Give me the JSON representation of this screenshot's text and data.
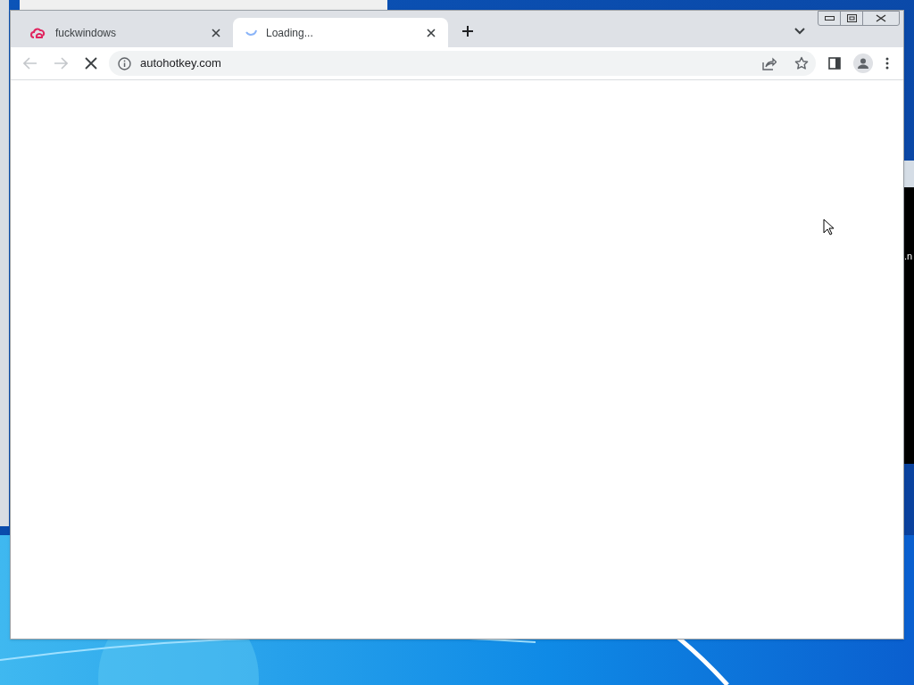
{
  "background_window": {
    "text": ".n"
  },
  "tabs": [
    {
      "title": "fuckwindows",
      "selected": false,
      "loading": false
    },
    {
      "title": "Loading...",
      "selected": true,
      "loading": true
    }
  ],
  "toolbar": {
    "address": "autohotkey.com",
    "loading": true
  }
}
